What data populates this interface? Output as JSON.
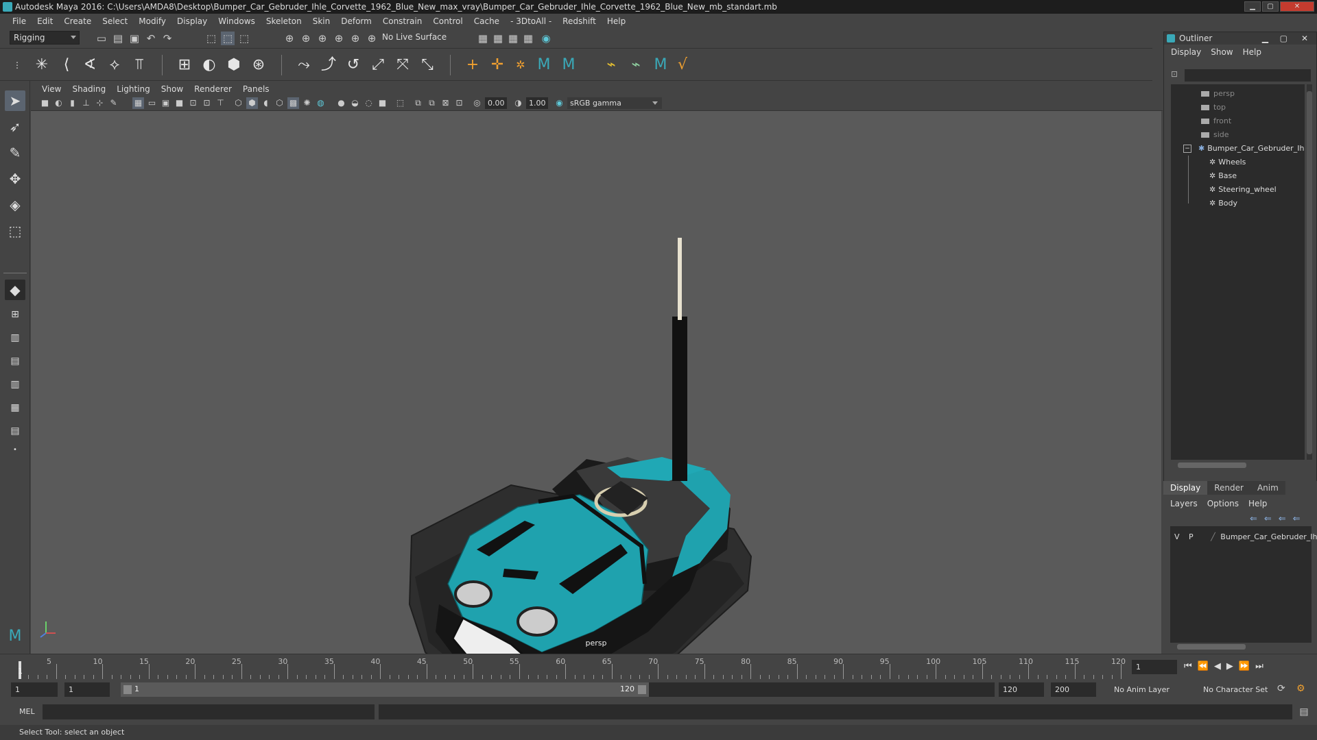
{
  "title": "Autodesk Maya 2016: C:\\Users\\AMDA8\\Desktop\\Bumper_Car_Gebruder_Ihle_Corvette_1962_Blue_New_max_vray\\Bumper_Car_Gebruder_Ihle_Corvette_1962_Blue_New_mb_standart.mb",
  "menu": [
    "File",
    "Edit",
    "Create",
    "Select",
    "Modify",
    "Display",
    "Windows",
    "Skeleton",
    "Skin",
    "Deform",
    "Constrain",
    "Control",
    "Cache",
    "- 3DtoAll -",
    "Redshift",
    "Help"
  ],
  "status": {
    "mode": "Rigging",
    "live_surface": "No Live Surface"
  },
  "panel_menu": [
    "View",
    "Shading",
    "Lighting",
    "Show",
    "Renderer",
    "Panels"
  ],
  "panel_tools": {
    "exposure": "0.00",
    "gamma": "1.00",
    "colorspace": "sRGB gamma"
  },
  "viewport": {
    "camera": "persp",
    "colors": {
      "body": "#1fa2ae",
      "base": "#2e2e2e"
    }
  },
  "outliner": {
    "title": "Outliner",
    "menu": [
      "Display",
      "Show",
      "Help"
    ],
    "cameras": [
      "persp",
      "top",
      "front",
      "side"
    ],
    "root": "Bumper_Car_Gebruder_Ih",
    "children": [
      "Wheels",
      "Base",
      "Steering_wheel",
      "Body"
    ]
  },
  "layers": {
    "tabs": [
      "Display",
      "Render",
      "Anim"
    ],
    "menu": [
      "Layers",
      "Options",
      "Help"
    ],
    "row": {
      "v": "V",
      "p": "P",
      "name": "Bumper_Car_Gebruder_Ih"
    }
  },
  "timeline": {
    "labels": [
      "5",
      "10",
      "15",
      "20",
      "25",
      "30",
      "35",
      "40",
      "45",
      "50",
      "55",
      "60",
      "65",
      "70",
      "75",
      "80",
      "85",
      "90",
      "95",
      "100",
      "105",
      "110",
      "115",
      "120"
    ],
    "current_marker": "1",
    "current_field": "1"
  },
  "range": {
    "start": "1",
    "start2": "1",
    "slider_start": "1",
    "slider_end": "120",
    "end": "120",
    "end2": "200",
    "anim_layer": "No Anim Layer",
    "char_set": "No Character Set"
  },
  "cmd": {
    "label": "MEL"
  },
  "help_line": "Select Tool: select an object"
}
